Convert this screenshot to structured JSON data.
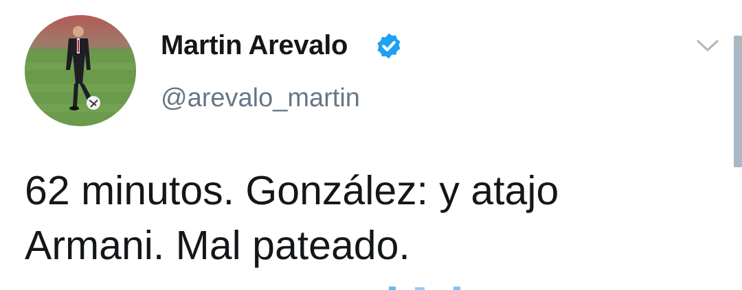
{
  "tweet": {
    "author": {
      "display_name": "Martin Arevalo",
      "handle": "@arevalo_martin",
      "verified": true,
      "verified_icon": "verified-badge-icon",
      "avatar_icon": "profile-photo"
    },
    "text_lines": [
      "62 minutos. González: y atajo",
      "Armani. Mal pateado."
    ],
    "menu_icon": "chevron-down-icon"
  },
  "colors": {
    "text": "#14171a",
    "secondary": "#657786",
    "verified": "#1da1f2",
    "chevron": "#aab8c2",
    "scrollbar": "#aab8c2"
  }
}
